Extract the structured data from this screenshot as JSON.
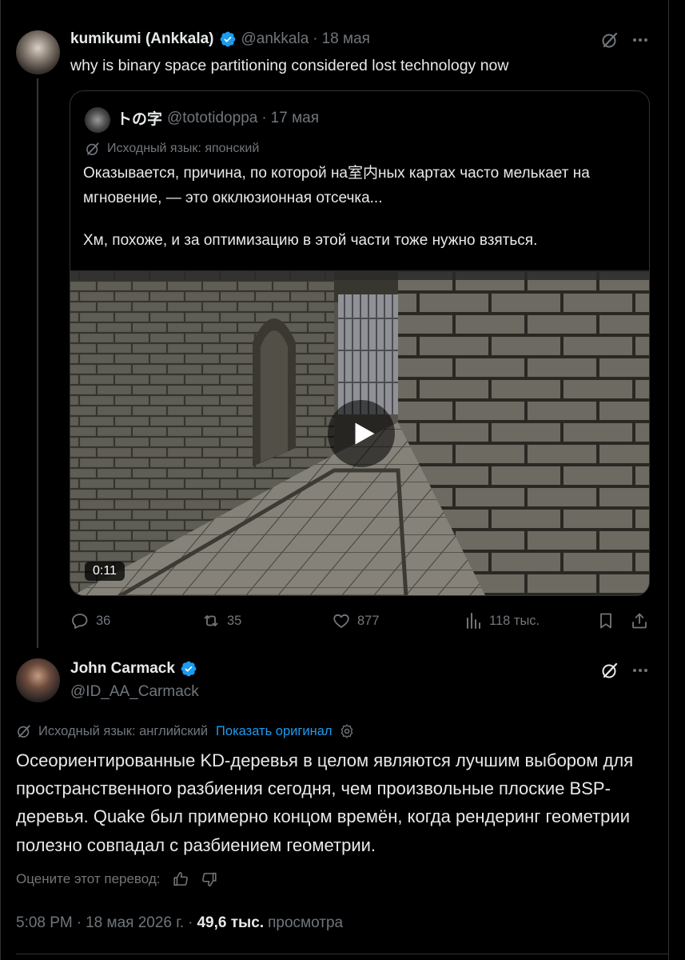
{
  "first_post": {
    "author_name": "kumikumi (Ankkala)",
    "handle": "@ankkala",
    "separator": "·",
    "date": "18 мая",
    "text": "why is binary space partitioning considered lost technology now",
    "quote": {
      "author_name": "トの字",
      "handle": "@tototidoppa",
      "date": "17 мая",
      "source_language": "Исходный язык: японский",
      "text_line1": "Оказывается, причина, по которой на室内ных картах часто мелькает на мгновение, — это окклюзионная отсечка...",
      "text_line2": "Хм, похоже, и за оптимизацию в этой части тоже нужно взяться.",
      "video_duration": "0:11"
    },
    "actions": {
      "replies": "36",
      "reposts": "35",
      "likes": "877",
      "views": "118 тыс."
    }
  },
  "main_post": {
    "author_name": "John Carmack",
    "handle": "@ID_AA_Carmack",
    "source_language": "Исходный язык: английский",
    "show_original": "Показать оригинал",
    "text": "Осеориентированные KD-деревья в целом являются лучшим выбором для пространственного разбиения сегодня, чем произвольные плоские BSP-деревья. Quake был примерно концом времён, когда рендеринг геометрии полезно совпадал с разбиением геометрии.",
    "rate_translation": "Оцените этот перевод:",
    "time": "5:08 PM",
    "date": "18 мая 2026 г.",
    "views_count": "49,6 тыс.",
    "views_label": "просмотра"
  },
  "colors": {
    "background": "#000000",
    "text": "#e7e9ea",
    "muted": "#71767b",
    "accent": "#1d9bf0",
    "border": "#2f3336"
  }
}
